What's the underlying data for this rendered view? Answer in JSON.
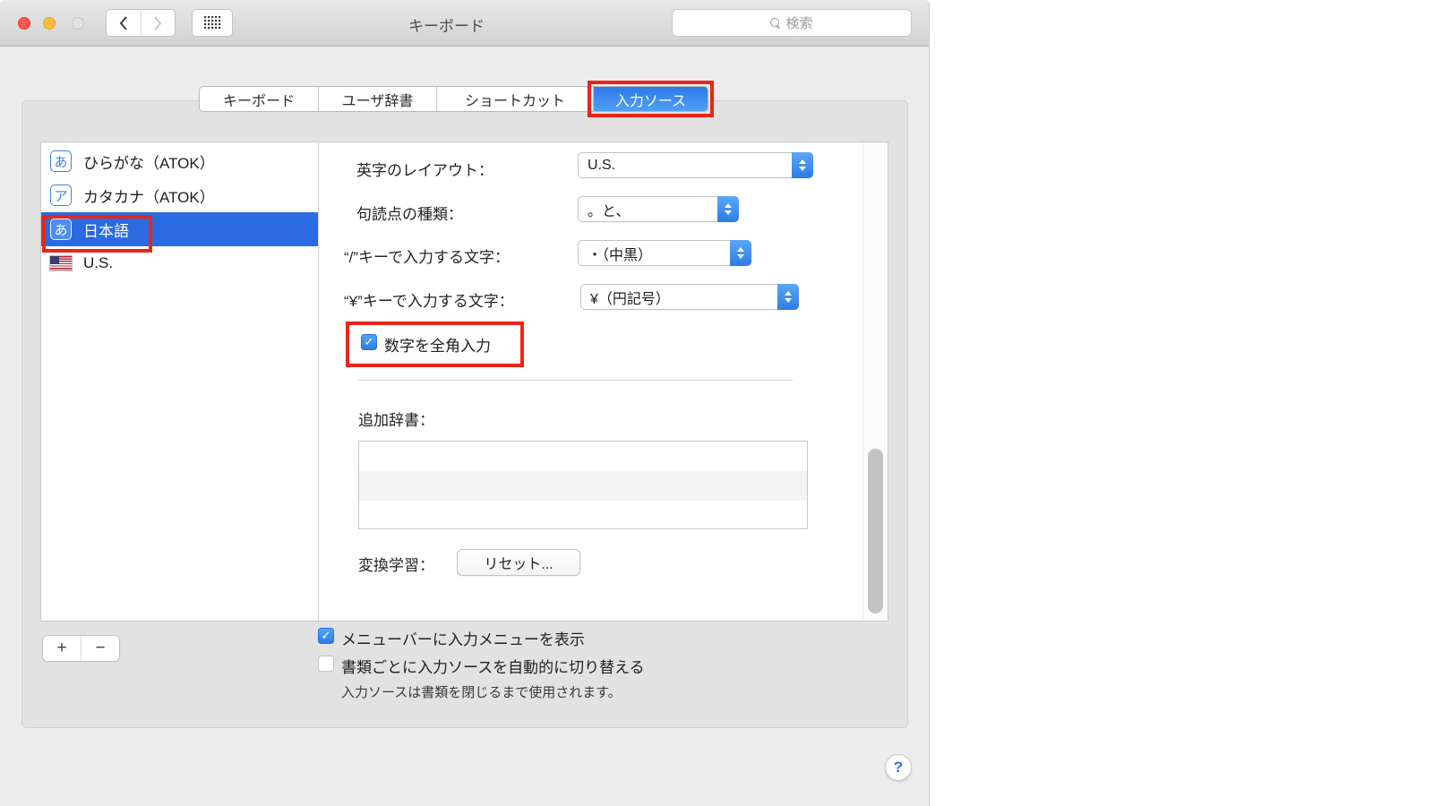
{
  "titlebar": {
    "title": "キーボード",
    "search_placeholder": "検索"
  },
  "tabs": {
    "items": [
      {
        "label": "キーボード"
      },
      {
        "label": "ユーザ辞書"
      },
      {
        "label": "ショートカット"
      },
      {
        "label": "入力ソース"
      }
    ],
    "selected_index": 3
  },
  "source_list": {
    "items": [
      {
        "badge": "あ",
        "label": "ひらがな（ATOK）",
        "selected": false
      },
      {
        "badge": "ア",
        "label": "カタカナ（ATOK）",
        "selected": false
      },
      {
        "badge": "あ",
        "label": "日本語",
        "selected": true
      },
      {
        "badge": "",
        "label": "U.S.",
        "selected": false
      }
    ]
  },
  "form": {
    "rows": [
      {
        "label": "英字のレイアウト：",
        "value": "U.S."
      },
      {
        "label": "句読点の種類：",
        "value": "。と、"
      },
      {
        "label": "“/”キーで入力する文字：",
        "value": "・（中黒）"
      },
      {
        "label": "“¥”キーで入力する文字：",
        "value": "¥（円記号）"
      }
    ],
    "fullwidth_numerals": {
      "label": "数字を全角入力",
      "checked": true
    },
    "additional_dictionaries_label": "追加辞書：",
    "conversion_learning_label": "変換学習：",
    "reset_button_label": "リセット...",
    "checkmark": "✓"
  },
  "footer": {
    "add_label": "+",
    "remove_label": "−",
    "show_input_menu": {
      "label": "メニューバーに入力メニューを表示",
      "checked": true
    },
    "auto_switch": {
      "label": "書類ごとに入力ソースを自動的に切り替える",
      "checked": false
    },
    "note": "入力ソースは書類を閉じるまで使用されます。"
  },
  "help_label": "?",
  "colors": {
    "selection_blue": "#2a6be2",
    "tab_blue_top": "#2e7ae8",
    "tab_blue_bottom": "#4f9ff6",
    "annotation_red": "#ea2518",
    "window_bg": "#ececec",
    "groupbox_bg": "#e2e2e2"
  }
}
